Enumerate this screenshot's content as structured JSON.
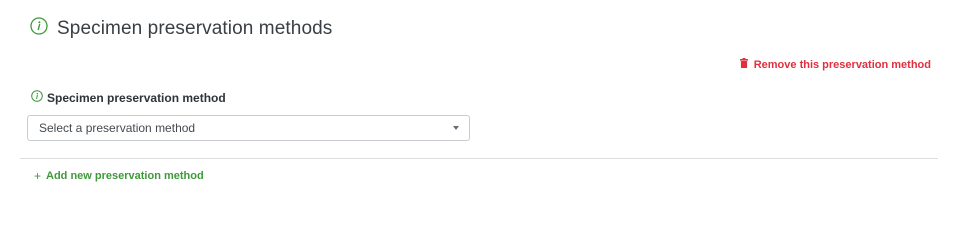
{
  "section": {
    "title": "Specimen preservation methods",
    "icon": "info-icon"
  },
  "remove_link": {
    "label": "Remove this preservation method",
    "icon": "trash-icon",
    "color": "#e0303f"
  },
  "field": {
    "label": "Specimen preservation method",
    "icon": "info-icon",
    "select_value": "Select a preservation method"
  },
  "add_link": {
    "label": "Add new preservation method",
    "icon": "plus-icon",
    "color": "#3f9a3a"
  },
  "colors": {
    "accent_green": "#3f9a3a",
    "danger_red": "#e0303f",
    "border": "#c9cdd1"
  }
}
